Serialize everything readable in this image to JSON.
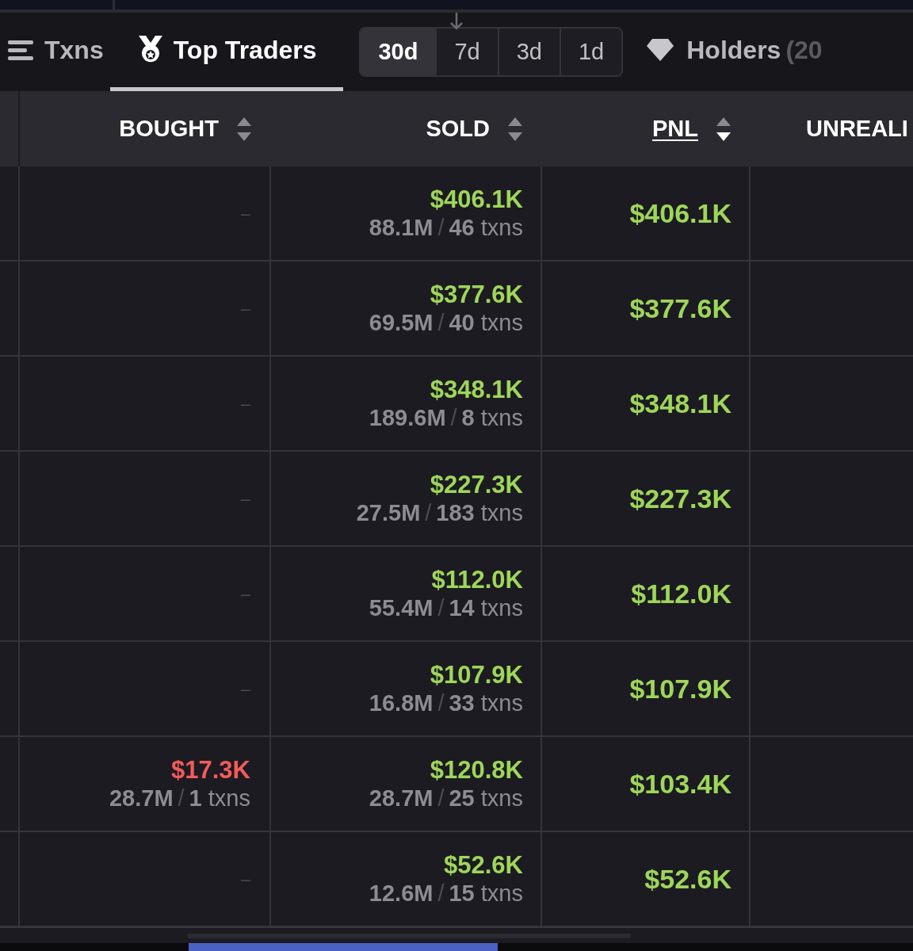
{
  "tabs": [
    {
      "label": "Txns",
      "selected": false
    },
    {
      "label": "Top Traders",
      "selected": true
    }
  ],
  "periods": [
    {
      "label": "30d",
      "selected": true
    },
    {
      "label": "7d",
      "selected": false
    },
    {
      "label": "3d",
      "selected": false
    },
    {
      "label": "1d",
      "selected": false
    }
  ],
  "holders_tab": {
    "label": "Holders",
    "count": "(20",
    "selected": false
  },
  "columns": [
    {
      "label": "BOUGHT",
      "kind": "sortable",
      "sorted": false
    },
    {
      "label": "SOLD",
      "kind": "sortable",
      "sorted": false
    },
    {
      "label": "PNL",
      "kind": "sortable",
      "sorted": true
    },
    {
      "label": "UNREALI",
      "kind": "plain"
    }
  ],
  "rows": [
    {
      "bought": {
        "kind": "dash",
        "text": "–"
      },
      "sold": {
        "amount": "$406.1K",
        "tokens": "88.1M",
        "sep": "/",
        "count": "46",
        "unit": "txns"
      },
      "pnl": "$406.1K"
    },
    {
      "bought": {
        "kind": "dash",
        "text": "–"
      },
      "sold": {
        "amount": "$377.6K",
        "tokens": "69.5M",
        "sep": "/",
        "count": "40",
        "unit": "txns"
      },
      "pnl": "$377.6K"
    },
    {
      "bought": {
        "kind": "dash",
        "text": "–"
      },
      "sold": {
        "amount": "$348.1K",
        "tokens": "189.6M",
        "sep": "/",
        "count": "8",
        "unit": "txns"
      },
      "pnl": "$348.1K"
    },
    {
      "bought": {
        "kind": "dash",
        "text": "–"
      },
      "sold": {
        "amount": "$227.3K",
        "tokens": "27.5M",
        "sep": "/",
        "count": "183",
        "unit": "txns"
      },
      "pnl": "$227.3K"
    },
    {
      "bought": {
        "kind": "dash",
        "text": "–"
      },
      "sold": {
        "amount": "$112.0K",
        "tokens": "55.4M",
        "sep": "/",
        "count": "14",
        "unit": "txns"
      },
      "pnl": "$112.0K"
    },
    {
      "bought": {
        "kind": "dash",
        "text": "–"
      },
      "sold": {
        "amount": "$107.9K",
        "tokens": "16.8M",
        "sep": "/",
        "count": "33",
        "unit": "txns"
      },
      "pnl": "$107.9K"
    },
    {
      "bought": {
        "kind": "trade",
        "amount": "$17.3K",
        "tokens": "28.7M",
        "sep": "/",
        "count": "1",
        "unit": "txns"
      },
      "sold": {
        "amount": "$120.8K",
        "tokens": "28.7M",
        "sep": "/",
        "count": "25",
        "unit": "txns"
      },
      "pnl": "$103.4K"
    },
    {
      "bought": {
        "kind": "dash",
        "text": "–"
      },
      "sold": {
        "amount": "$52.6K",
        "tokens": "12.6M",
        "sep": "/",
        "count": "15",
        "unit": "txns"
      },
      "pnl": "$52.6K"
    }
  ]
}
